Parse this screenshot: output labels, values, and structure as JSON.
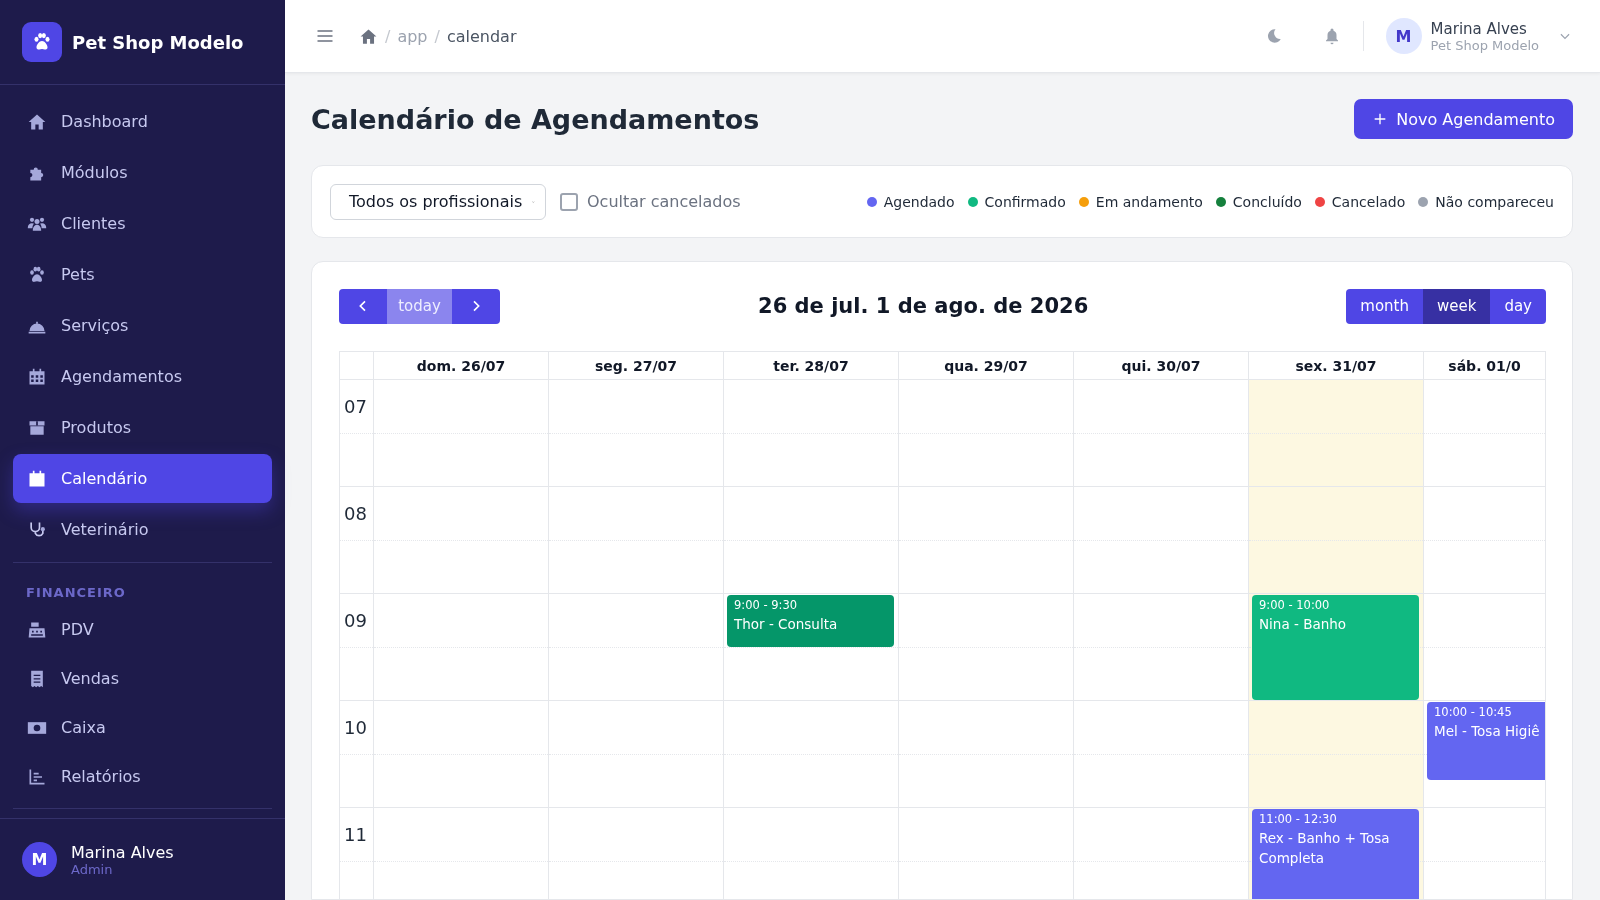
{
  "brand": {
    "name": "Pet Shop Modelo"
  },
  "sidebar": {
    "items": [
      {
        "label": "Dashboard",
        "selected": false
      },
      {
        "label": "Módulos",
        "selected": false
      },
      {
        "label": "Clientes",
        "selected": false
      },
      {
        "label": "Pets",
        "selected": false
      },
      {
        "label": "Serviços",
        "selected": false
      },
      {
        "label": "Agendamentos",
        "selected": false
      },
      {
        "label": "Produtos",
        "selected": false
      },
      {
        "label": "Calendário",
        "selected": true
      },
      {
        "label": "Veterinário",
        "selected": false
      }
    ],
    "section_title": "FINANCEIRO",
    "finance_items": [
      {
        "label": "PDV",
        "selected": false
      },
      {
        "label": "Vendas",
        "selected": false
      },
      {
        "label": "Caixa",
        "selected": false
      },
      {
        "label": "Relatórios",
        "selected": false
      }
    ],
    "user": {
      "initial": "M",
      "name": "Marina Alves",
      "role": "Admin"
    }
  },
  "topbar": {
    "separator": "/",
    "breadcrumb": [
      "app",
      "calendar"
    ],
    "user": {
      "initial": "M",
      "name": "Marina Alves",
      "company": "Pet Shop Modelo"
    }
  },
  "page_title": "Calendário de Agendamentos",
  "new_button": "Novo Agendamento",
  "filters": {
    "professional": "Todos os profissionais",
    "hide_cancelled": {
      "label": "Ocultar cancelados",
      "checked": false
    },
    "legend": [
      {
        "label": "Agendado",
        "color": "#6366f1"
      },
      {
        "label": "Confirmado",
        "color": "#10b981"
      },
      {
        "label": "Em andamento",
        "color": "#f59e0b"
      },
      {
        "label": "Concluído",
        "color": "#15803d"
      },
      {
        "label": "Cancelado",
        "color": "#ef4444"
      },
      {
        "label": "Não compareceu",
        "color": "#9ca3af"
      }
    ]
  },
  "calendar": {
    "nav": {
      "today": "today"
    },
    "range_title": "26 de jul. 1 de ago. de 2026",
    "views": [
      {
        "label": "month",
        "selected": false
      },
      {
        "label": "week",
        "selected": true
      },
      {
        "label": "day",
        "selected": false
      }
    ],
    "hours": [
      "07",
      "08",
      "09",
      "10",
      "11"
    ],
    "days": [
      {
        "label": "dom. 26/07",
        "today": false
      },
      {
        "label": "seg. 27/07",
        "today": false
      },
      {
        "label": "ter. 28/07",
        "today": false,
        "events": [
          {
            "time": "9:00 - 9:30",
            "title": "Thor - Consulta",
            "color": "#059669"
          }
        ]
      },
      {
        "label": "qua. 29/07",
        "today": false
      },
      {
        "label": "qui. 30/07",
        "today": false
      },
      {
        "label": "sex. 31/07",
        "today": true,
        "events": [
          {
            "time": "9:00 - 10:00",
            "title": "Nina - Banho",
            "color": "#10b981"
          },
          {
            "time": "11:00 - 12:30",
            "title": "Rex - Banho + Tosa Completa",
            "color": "#6366f1"
          }
        ]
      },
      {
        "label": "sáb. 01/0",
        "today": false,
        "events": [
          {
            "time": "10:00 - 10:45",
            "title": "Mel - Tosa Higiê",
            "color": "#6366f1"
          }
        ]
      }
    ]
  }
}
